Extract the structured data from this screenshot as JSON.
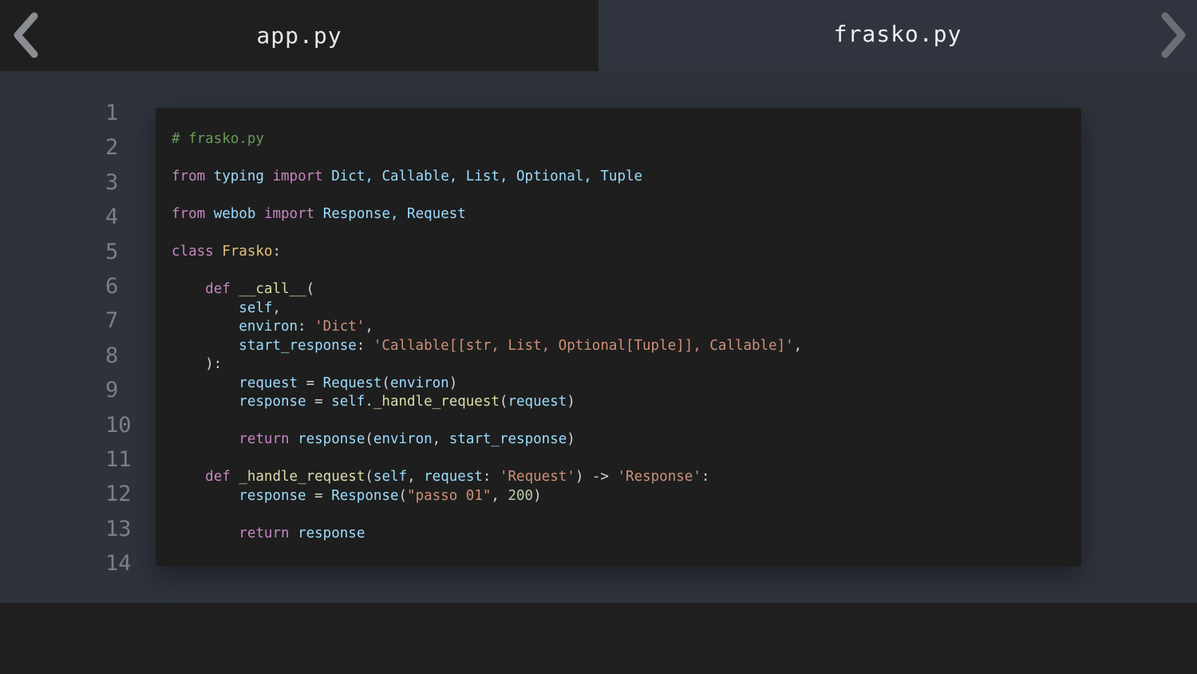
{
  "tabs": [
    {
      "label": "app.py",
      "active": false
    },
    {
      "label": "frasko.py",
      "active": true
    }
  ],
  "nav": {
    "prev_icon": "chevron-left-icon",
    "next_icon": "chevron-right-icon"
  },
  "line_numbers": [
    "1",
    "2",
    "3",
    "4",
    "5",
    "6",
    "7",
    "8",
    "9",
    "10",
    "11",
    "12",
    "13",
    "14"
  ],
  "code_lines": [
    [
      {
        "t": "# frasko.py",
        "c": "c"
      }
    ],
    [],
    [
      {
        "t": "from",
        "c": "k"
      },
      {
        "t": " ",
        "c": "p"
      },
      {
        "t": "typing",
        "c": "v"
      },
      {
        "t": " ",
        "c": "p"
      },
      {
        "t": "import",
        "c": "k"
      },
      {
        "t": " Dict, Callable, List, Optional, Tuple",
        "c": "v"
      }
    ],
    [],
    [
      {
        "t": "from",
        "c": "k"
      },
      {
        "t": " ",
        "c": "p"
      },
      {
        "t": "webob",
        "c": "v"
      },
      {
        "t": " ",
        "c": "p"
      },
      {
        "t": "import",
        "c": "k"
      },
      {
        "t": " Response, Request",
        "c": "v"
      }
    ],
    [],
    [
      {
        "t": "class",
        "c": "k"
      },
      {
        "t": " ",
        "c": "p"
      },
      {
        "t": "Frasko",
        "c": "cls"
      },
      {
        "t": ":",
        "c": "p"
      }
    ],
    [],
    [
      {
        "t": "    ",
        "c": "p"
      },
      {
        "t": "def",
        "c": "k"
      },
      {
        "t": " ",
        "c": "p"
      },
      {
        "t": "__call__",
        "c": "ty"
      },
      {
        "t": "(",
        "c": "p"
      }
    ],
    [
      {
        "t": "        self,",
        "c": "v"
      }
    ],
    [
      {
        "t": "        environ",
        "c": "v"
      },
      {
        "t": ": ",
        "c": "p"
      },
      {
        "t": "'Dict'",
        "c": "s"
      },
      {
        "t": ",",
        "c": "p"
      }
    ],
    [
      {
        "t": "        start_response",
        "c": "v"
      },
      {
        "t": ": ",
        "c": "p"
      },
      {
        "t": "'Callable[[str, List, Optional[Tuple]], Callable]'",
        "c": "s"
      },
      {
        "t": ",",
        "c": "p"
      }
    ],
    [
      {
        "t": "    ):",
        "c": "p"
      }
    ],
    [
      {
        "t": "        request",
        "c": "v"
      },
      {
        "t": " = ",
        "c": "p"
      },
      {
        "t": "Request",
        "c": "v"
      },
      {
        "t": "(",
        "c": "p"
      },
      {
        "t": "environ",
        "c": "v"
      },
      {
        "t": ")",
        "c": "p"
      }
    ],
    [
      {
        "t": "        response",
        "c": "v"
      },
      {
        "t": " = ",
        "c": "p"
      },
      {
        "t": "self.",
        "c": "v"
      },
      {
        "t": "_handle_request",
        "c": "ty"
      },
      {
        "t": "(",
        "c": "p"
      },
      {
        "t": "request",
        "c": "v"
      },
      {
        "t": ")",
        "c": "p"
      }
    ],
    [],
    [
      {
        "t": "        ",
        "c": "p"
      },
      {
        "t": "return",
        "c": "k"
      },
      {
        "t": " ",
        "c": "p"
      },
      {
        "t": "response",
        "c": "v"
      },
      {
        "t": "(",
        "c": "p"
      },
      {
        "t": "environ",
        "c": "v"
      },
      {
        "t": ", ",
        "c": "p"
      },
      {
        "t": "start_response",
        "c": "v"
      },
      {
        "t": ")",
        "c": "p"
      }
    ],
    [],
    [
      {
        "t": "    ",
        "c": "p"
      },
      {
        "t": "def",
        "c": "k"
      },
      {
        "t": " ",
        "c": "p"
      },
      {
        "t": "_handle_request",
        "c": "ty"
      },
      {
        "t": "(",
        "c": "p"
      },
      {
        "t": "self",
        "c": "v"
      },
      {
        "t": ", ",
        "c": "p"
      },
      {
        "t": "request",
        "c": "v"
      },
      {
        "t": ": ",
        "c": "p"
      },
      {
        "t": "'Request'",
        "c": "s"
      },
      {
        "t": ") -> ",
        "c": "p"
      },
      {
        "t": "'Response'",
        "c": "s"
      },
      {
        "t": ":",
        "c": "p"
      }
    ],
    [
      {
        "t": "        response",
        "c": "v"
      },
      {
        "t": " = ",
        "c": "p"
      },
      {
        "t": "Response",
        "c": "v"
      },
      {
        "t": "(",
        "c": "p"
      },
      {
        "t": "\"passo 01\"",
        "c": "s"
      },
      {
        "t": ", ",
        "c": "p"
      },
      {
        "t": "200",
        "c": "n"
      },
      {
        "t": ")",
        "c": "p"
      }
    ],
    [],
    [
      {
        "t": "        ",
        "c": "p"
      },
      {
        "t": "return",
        "c": "k"
      },
      {
        "t": " ",
        "c": "p"
      },
      {
        "t": "response",
        "c": "v"
      }
    ]
  ]
}
